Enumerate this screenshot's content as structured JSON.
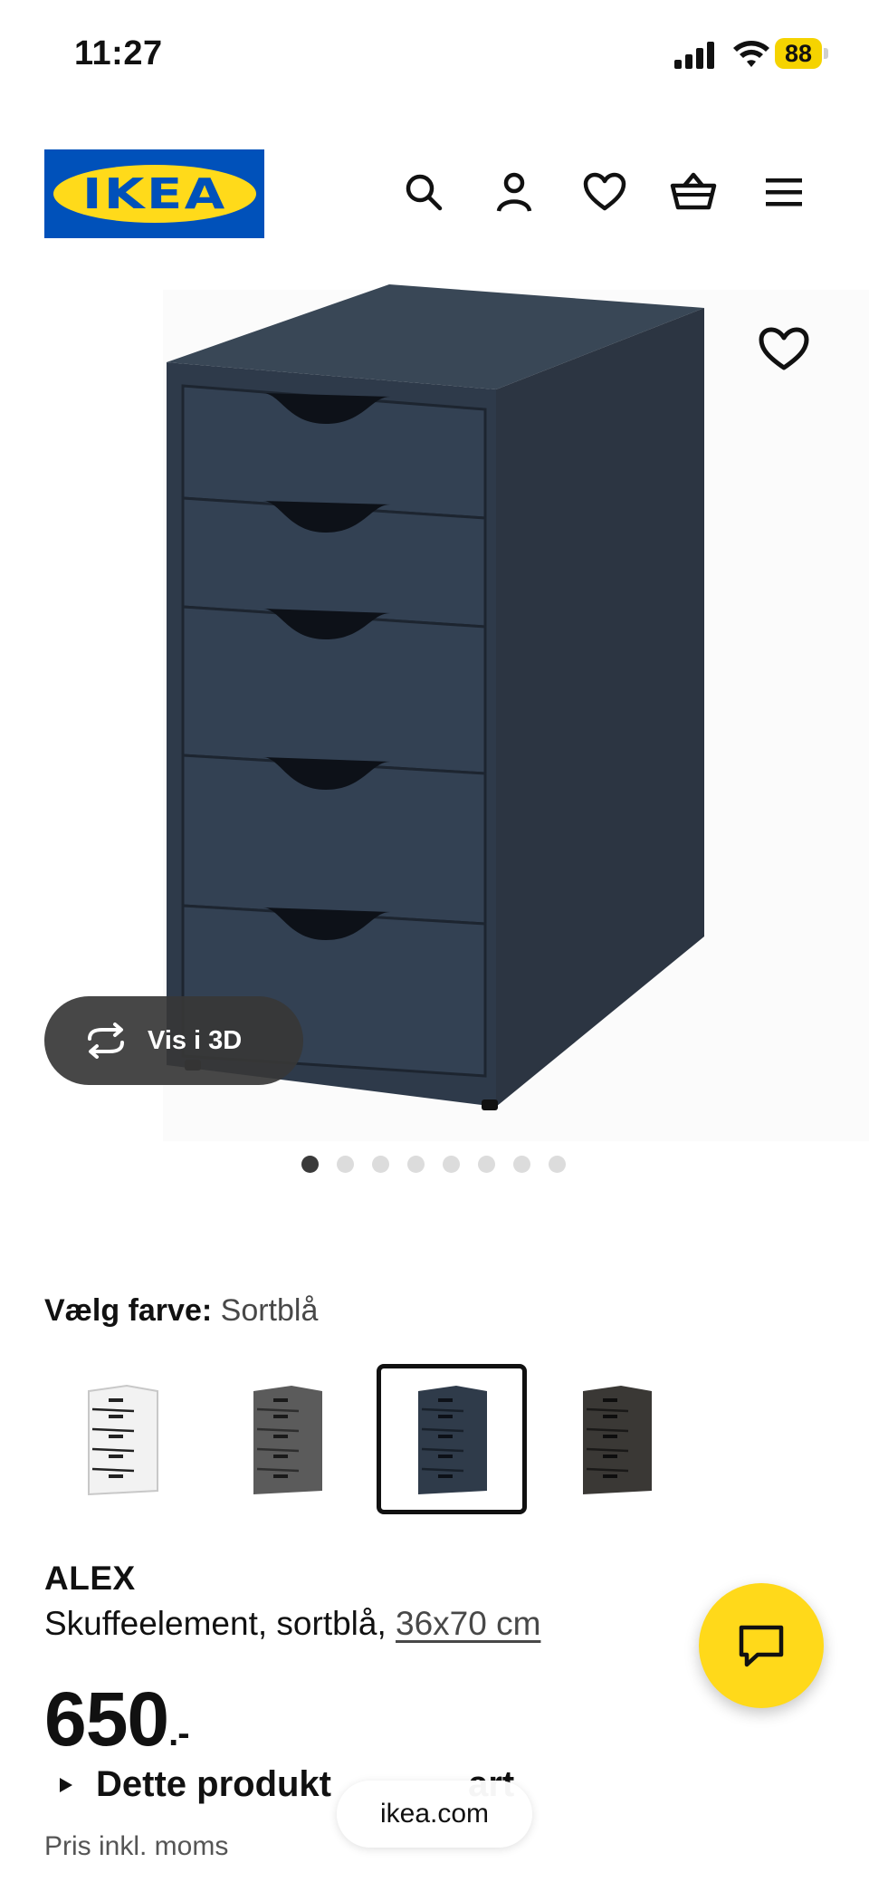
{
  "status_bar": {
    "time": "11:27",
    "battery": "88"
  },
  "header": {
    "logo_text": "IKEA",
    "icons": [
      "search-icon",
      "account-icon",
      "heart-icon",
      "basket-icon",
      "menu-icon"
    ]
  },
  "gallery": {
    "view_3d_label": "Vis i 3D",
    "image_count": 8,
    "active_index": 0
  },
  "color_selector": {
    "label": "Vælg farve:",
    "value": "Sortblå",
    "options": [
      {
        "name": "white",
        "color": "#f4f4f4"
      },
      {
        "name": "gray",
        "color": "#5b5b5b"
      },
      {
        "name": "dark-blue",
        "color": "#2f3b4a",
        "selected": true
      },
      {
        "name": "black-brown",
        "color": "#3a3835"
      }
    ]
  },
  "product": {
    "name": "ALEX",
    "description": "Skuffeelement, sortblå, ",
    "size": "36x70 cm",
    "price": "650",
    "price_suffix": ".-",
    "info_text": "Dette produkt        art",
    "vat_text": "Pris inkl. moms"
  },
  "browser": {
    "url": "ikea.com"
  },
  "colors": {
    "brand_blue": "#0051ba",
    "brand_yellow": "#ffda1a",
    "product": "#2f3b4a"
  }
}
